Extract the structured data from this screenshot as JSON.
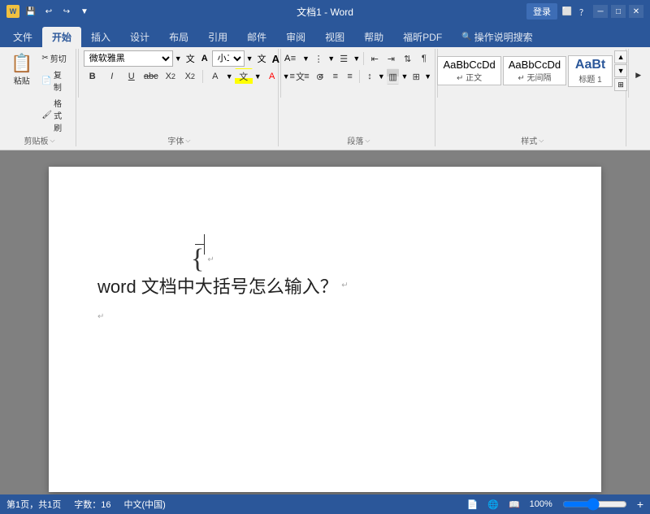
{
  "titlebar": {
    "title": "文档1 - Word",
    "login_label": "登录",
    "app_icon": "W",
    "quick_access": [
      "save",
      "undo",
      "redo",
      "customize"
    ],
    "window_buttons": [
      "─",
      "□",
      "✕"
    ]
  },
  "tabs": [
    {
      "label": "文件",
      "active": false
    },
    {
      "label": "开始",
      "active": true
    },
    {
      "label": "插入",
      "active": false
    },
    {
      "label": "设计",
      "active": false
    },
    {
      "label": "布局",
      "active": false
    },
    {
      "label": "引用",
      "active": false
    },
    {
      "label": "邮件",
      "active": false
    },
    {
      "label": "审阅",
      "active": false
    },
    {
      "label": "视图",
      "active": false
    },
    {
      "label": "帮助",
      "active": false
    },
    {
      "label": "福昕PDF",
      "active": false
    },
    {
      "label": "操作说明搜索",
      "active": false
    }
  ],
  "ribbon": {
    "clipboard": {
      "label": "剪贴板",
      "paste": "粘贴",
      "cut": "剪切",
      "copy": "复制",
      "format_painter": "格式刷"
    },
    "font": {
      "label": "字体",
      "font_name": "微软雅黑",
      "font_size": "小二",
      "bold": "B",
      "italic": "I",
      "underline": "U",
      "strikethrough": "abc",
      "sub": "X₂",
      "sup": "X²",
      "clear_format": "A",
      "font_color": "A",
      "highlight": "文",
      "increase_size": "A",
      "decrease_size": "A",
      "change_case": "文",
      "phonetic": "文"
    },
    "paragraph": {
      "label": "段落"
    },
    "styles": {
      "label": "样式",
      "items": [
        {
          "name": "正文",
          "preview": "AaBbCcDd"
        },
        {
          "name": "无间隔",
          "preview": "AaBbCcDd"
        },
        {
          "name": "标题 1",
          "preview": "AaBt"
        }
      ]
    }
  },
  "document": {
    "brace": "{",
    "main_text": "word 文档中大括号怎么输入？",
    "para_mark": "↵",
    "return_mark": "↵"
  },
  "statusbar": {
    "pages": "第1页，共1页",
    "words": "字数：16",
    "language": "中文(中国)",
    "zoom": "100%"
  }
}
